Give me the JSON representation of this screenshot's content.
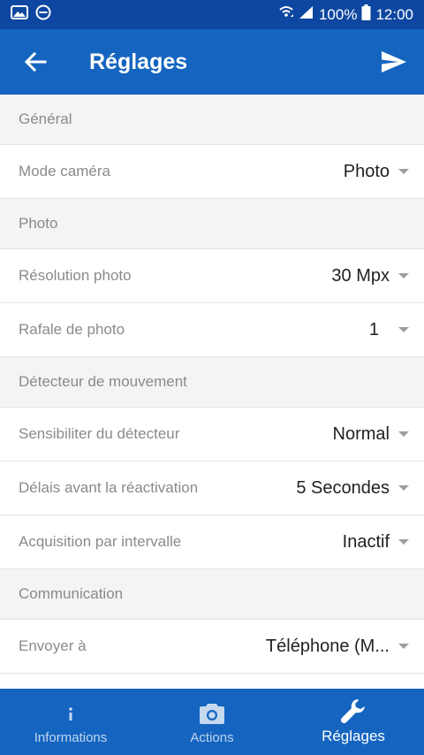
{
  "status_bar": {
    "battery": "100%",
    "time": "12:00"
  },
  "app_bar": {
    "title": "Réglages"
  },
  "sections": [
    {
      "header": "Général",
      "rows": [
        {
          "label": "Mode caméra",
          "value": "Photo"
        }
      ]
    },
    {
      "header": "Photo",
      "rows": [
        {
          "label": "Résolution photo",
          "value": "30 Mpx"
        },
        {
          "label": "Rafale de photo",
          "value": "1"
        }
      ]
    },
    {
      "header": "Détecteur de mouvement",
      "rows": [
        {
          "label": "Sensibiliter du détecteur",
          "value": "Normal"
        },
        {
          "label": "Délais avant la réactivation",
          "value": "5 Secondes"
        },
        {
          "label": "Acquisition par intervalle",
          "value": "Inactif"
        }
      ]
    },
    {
      "header": "Communication",
      "rows": [
        {
          "label": "Envoyer à",
          "value": "Téléphone (M..."
        }
      ]
    }
  ],
  "bottom_nav": {
    "items": [
      {
        "label": "Informations",
        "icon": "info-icon"
      },
      {
        "label": "Actions",
        "icon": "camera-icon"
      },
      {
        "label": "Réglages",
        "icon": "wrench-icon",
        "active": true
      }
    ]
  },
  "colors": {
    "primary": "#1565c0",
    "status_bar": "#0d47a1",
    "section_bg": "#f4f4f4",
    "label_text": "#8a8a8a",
    "value_text": "#212121"
  }
}
